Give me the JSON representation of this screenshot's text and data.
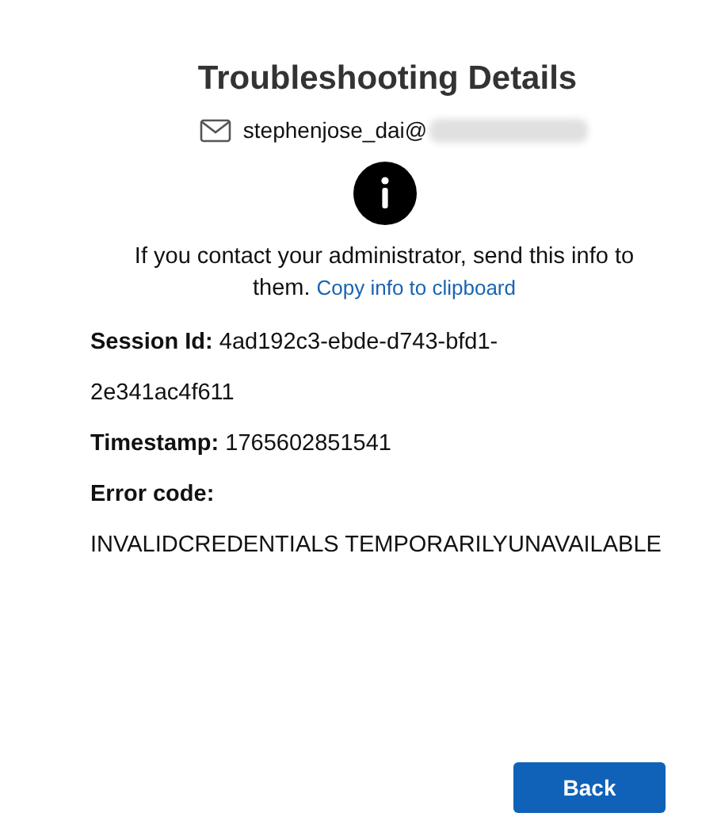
{
  "title": "Troubleshooting Details",
  "account": {
    "email": "stephenjose_dai@",
    "redacted": true
  },
  "message": {
    "text": "If you contact your administrator, send this info to them.",
    "link": "Copy info to clipboard"
  },
  "details": [
    {
      "text": "**Session Id:** 4ad192c3-ebde-d743-bfd1-2e341ac4f611"
    },
    {
      "text": "**Timestamp:** 1765602851541"
    },
    {
      "text": "**Error code:**"
    },
    {
      "text": "INVALIDCREDENTIALS TEMPORARILYUNAVAILABLE"
    }
  ],
  "buttons": [
    {
      "label": "Back"
    }
  ]
}
